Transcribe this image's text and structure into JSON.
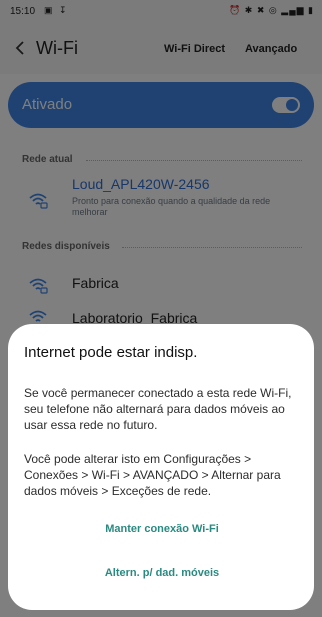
{
  "status_bar": {
    "time": "15:10",
    "left_icons": [
      "image-icon",
      "download-icon"
    ],
    "right_icons": [
      "alarm-icon",
      "bluetooth-icon",
      "mute-icon",
      "wifi-icon",
      "signal-icon",
      "battery-icon"
    ]
  },
  "app_bar": {
    "title": "Wi-Fi",
    "wifi_direct": "Wi-Fi Direct",
    "advanced": "Avançado"
  },
  "toggle": {
    "label": "Ativado",
    "enabled": true
  },
  "current_network": {
    "section_title": "Rede atual",
    "name": "Loud_APL420W-2456",
    "status": "Pronto para conexão quando a qualidade da rede melhorar"
  },
  "available": {
    "section_title": "Redes disponíveis",
    "networks": [
      {
        "name": "Fabrica"
      },
      {
        "name": "Laboratorio_Fabrica"
      }
    ]
  },
  "dialog": {
    "title": "Internet pode estar indisp.",
    "paragraph1": "Se você permanecer conectado a esta rede Wi-Fi, seu telefone não alternará para dados móveis ao usar essa rede no futuro.",
    "paragraph2": "Você pode alterar isto em Configurações > Conexões > Wi-Fi > AVANÇADO > Alternar para dados móveis > Exceções de rede.",
    "keep_button": "Manter conexão Wi-Fi",
    "switch_button": "Altern. p/ dad. móveis"
  },
  "colors": {
    "accent_blue": "#3e84e4",
    "connected_text": "#2f6fd4",
    "dialog_button": "#2b8a80"
  }
}
